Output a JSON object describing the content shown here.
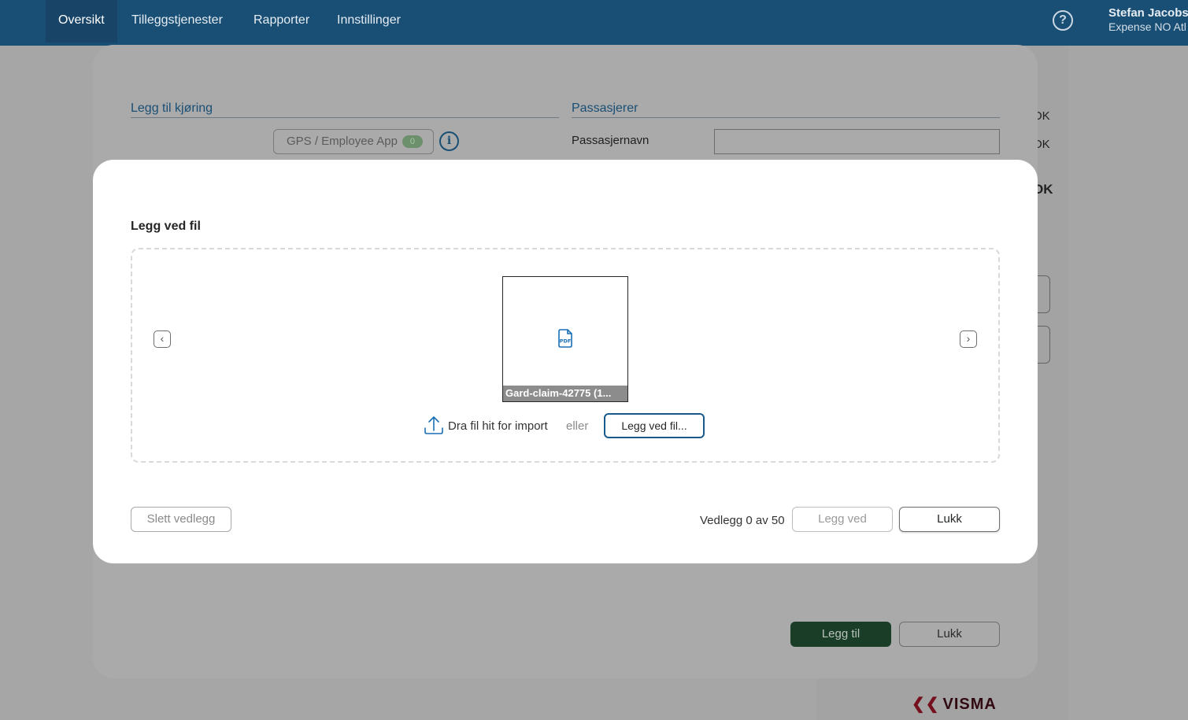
{
  "nav": {
    "tabs": [
      {
        "label": "Oversikt",
        "active": true
      },
      {
        "label": "Tilleggstjenester",
        "active": false
      },
      {
        "label": "Rapporter",
        "active": false
      },
      {
        "label": "Innstillinger",
        "active": false
      }
    ],
    "help_icon": "question-circle-icon",
    "user_name": "Stefan Jacobs",
    "user_company": "Expense NO Atl"
  },
  "background": {
    "fragments": [
      "OK",
      "OK",
      "OK"
    ],
    "logo": "VISMA"
  },
  "trip_dialog": {
    "section_left": "Legg til kjøring",
    "section_right": "Passasjerer",
    "gps_button": "GPS / Employee App",
    "gps_badge": "0",
    "info_icon": "i",
    "passenger_label": "Passasjernavn",
    "passenger_value": "",
    "add_button": "Legg til",
    "close_button": "Lukk"
  },
  "attach_dialog": {
    "title": "Legg ved fil",
    "prev_icon": "chevron-left-icon",
    "next_icon": "chevron-right-icon",
    "file_name": "Gard-claim-42775 (1...",
    "file_icon": "pdf-icon",
    "drag_text": "Dra fil hit for import",
    "or_text": "eller",
    "browse_button": "Legg ved fil...",
    "delete_button": "Slett vedlegg",
    "count_text": "Vedlegg 0 av 50",
    "attach_button": "Legg ved",
    "close_button": "Lukk"
  },
  "colors": {
    "nav_bg": "#1a4f75",
    "accent": "#1a5a8a",
    "primary_button": "#1a3d27"
  }
}
